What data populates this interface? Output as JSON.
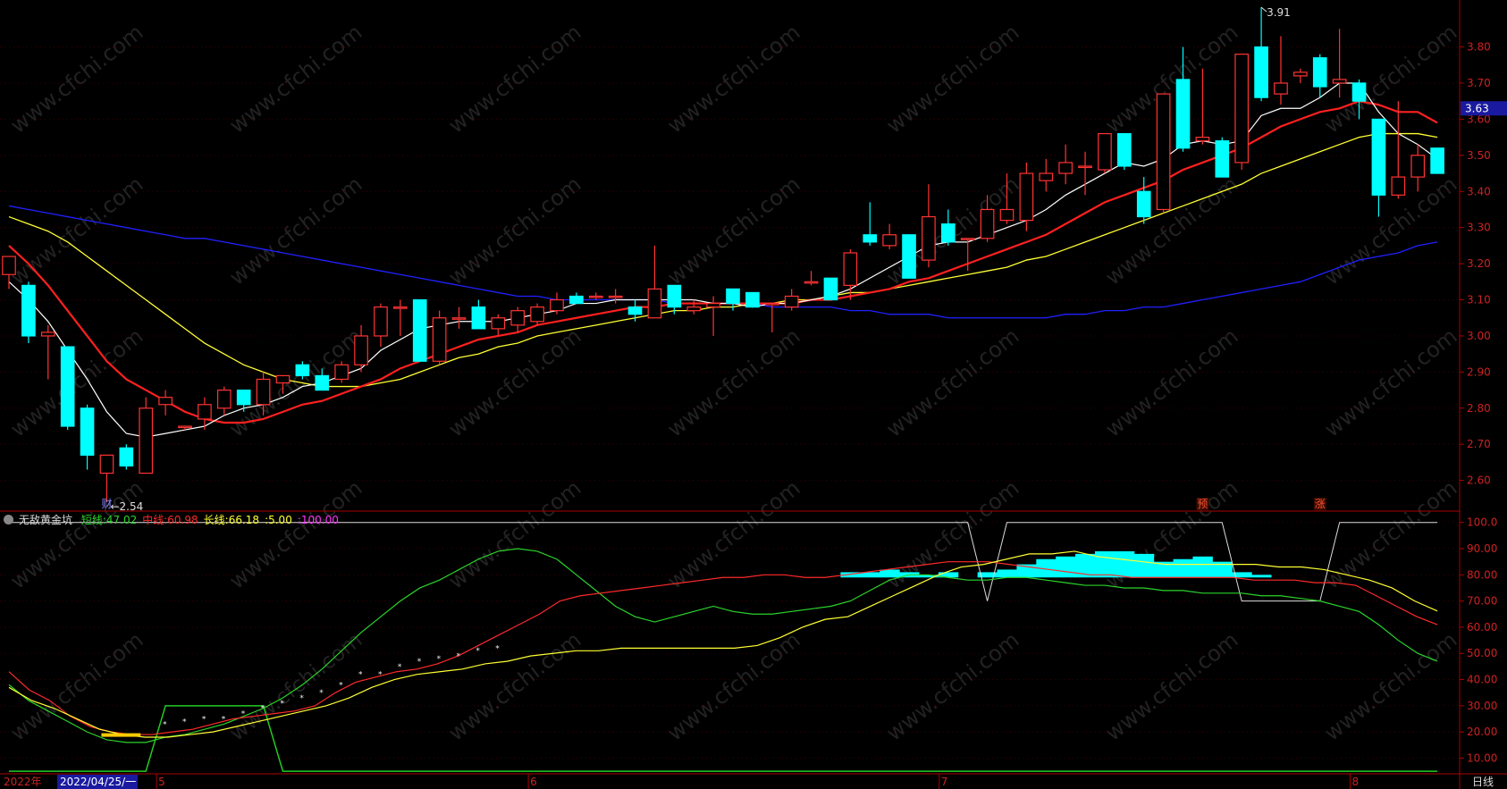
{
  "chart_data": [
    {
      "type": "candlestick",
      "ylim": [
        2.52,
        3.93
      ],
      "yticks": [
        "3.80",
        "3.70",
        "3.60",
        "3.50",
        "3.40",
        "3.30",
        "3.20",
        "3.10",
        "3.00",
        "2.90",
        "2.80",
        "2.70",
        "2.60"
      ],
      "ytick_values": [
        3.8,
        3.7,
        3.6,
        3.5,
        3.4,
        3.3,
        3.2,
        3.1,
        3.0,
        2.9,
        2.8,
        2.7,
        2.6
      ],
      "current_price": "3.63",
      "high_label": "3.91",
      "low_label": "2.54",
      "event_marks": [
        "财",
        "预",
        "涨"
      ],
      "bars": [
        {
          "o": 3.17,
          "h": 3.22,
          "l": 3.13,
          "c": 3.22
        },
        {
          "o": 3.14,
          "h": 3.15,
          "l": 2.98,
          "c": 3.0
        },
        {
          "o": 3.0,
          "h": 3.03,
          "l": 2.88,
          "c": 3.01
        },
        {
          "o": 2.97,
          "h": 2.97,
          "l": 2.74,
          "c": 2.75
        },
        {
          "o": 2.8,
          "h": 2.81,
          "l": 2.63,
          "c": 2.67
        },
        {
          "o": 2.62,
          "h": 2.67,
          "l": 2.54,
          "c": 2.67
        },
        {
          "o": 2.69,
          "h": 2.7,
          "l": 2.63,
          "c": 2.64
        },
        {
          "o": 2.62,
          "h": 2.83,
          "l": 2.62,
          "c": 2.8
        },
        {
          "o": 2.81,
          "h": 2.85,
          "l": 2.78,
          "c": 2.83
        },
        {
          "o": 2.75,
          "h": 2.75,
          "l": 2.74,
          "c": 2.75
        },
        {
          "o": 2.77,
          "h": 2.83,
          "l": 2.74,
          "c": 2.81
        },
        {
          "o": 2.8,
          "h": 2.86,
          "l": 2.78,
          "c": 2.85
        },
        {
          "o": 2.85,
          "h": 2.85,
          "l": 2.79,
          "c": 2.81
        },
        {
          "o": 2.81,
          "h": 2.9,
          "l": 2.78,
          "c": 2.88
        },
        {
          "o": 2.87,
          "h": 2.89,
          "l": 2.84,
          "c": 2.89
        },
        {
          "o": 2.92,
          "h": 2.93,
          "l": 2.88,
          "c": 2.89
        },
        {
          "o": 2.89,
          "h": 2.91,
          "l": 2.85,
          "c": 2.85
        },
        {
          "o": 2.88,
          "h": 2.93,
          "l": 2.87,
          "c": 2.92
        },
        {
          "o": 2.92,
          "h": 3.03,
          "l": 2.9,
          "c": 3.0
        },
        {
          "o": 3.0,
          "h": 3.09,
          "l": 2.97,
          "c": 3.08
        },
        {
          "o": 3.08,
          "h": 3.1,
          "l": 3.0,
          "c": 3.08
        },
        {
          "o": 3.1,
          "h": 3.1,
          "l": 2.93,
          "c": 2.93
        },
        {
          "o": 2.93,
          "h": 3.07,
          "l": 2.92,
          "c": 3.05
        },
        {
          "o": 3.05,
          "h": 3.08,
          "l": 3.02,
          "c": 3.05
        },
        {
          "o": 3.08,
          "h": 3.1,
          "l": 3.02,
          "c": 3.02
        },
        {
          "o": 3.02,
          "h": 3.06,
          "l": 3.0,
          "c": 3.05
        },
        {
          "o": 3.03,
          "h": 3.08,
          "l": 3.01,
          "c": 3.07
        },
        {
          "o": 3.04,
          "h": 3.09,
          "l": 3.03,
          "c": 3.08
        },
        {
          "o": 3.07,
          "h": 3.12,
          "l": 3.06,
          "c": 3.1
        },
        {
          "o": 3.11,
          "h": 3.12,
          "l": 3.09,
          "c": 3.09
        },
        {
          "o": 3.11,
          "h": 3.12,
          "l": 3.1,
          "c": 3.11
        },
        {
          "o": 3.11,
          "h": 3.13,
          "l": 3.09,
          "c": 3.11
        },
        {
          "o": 3.08,
          "h": 3.1,
          "l": 3.04,
          "c": 3.06
        },
        {
          "o": 3.05,
          "h": 3.25,
          "l": 3.05,
          "c": 3.13
        },
        {
          "o": 3.14,
          "h": 3.14,
          "l": 3.06,
          "c": 3.08
        },
        {
          "o": 3.07,
          "h": 3.1,
          "l": 3.06,
          "c": 3.08
        },
        {
          "o": 3.08,
          "h": 3.11,
          "l": 3.0,
          "c": 3.09
        },
        {
          "o": 3.13,
          "h": 3.13,
          "l": 3.07,
          "c": 3.09
        },
        {
          "o": 3.12,
          "h": 3.12,
          "l": 3.09,
          "c": 3.08
        },
        {
          "o": 3.09,
          "h": 3.09,
          "l": 3.01,
          "c": 3.09
        },
        {
          "o": 3.08,
          "h": 3.13,
          "l": 3.07,
          "c": 3.11
        },
        {
          "o": 3.15,
          "h": 3.18,
          "l": 3.14,
          "c": 3.15
        },
        {
          "o": 3.16,
          "h": 3.16,
          "l": 3.1,
          "c": 3.1
        },
        {
          "o": 3.14,
          "h": 3.24,
          "l": 3.1,
          "c": 3.23
        },
        {
          "o": 3.28,
          "h": 3.37,
          "l": 3.25,
          "c": 3.26
        },
        {
          "o": 3.25,
          "h": 3.31,
          "l": 3.24,
          "c": 3.28
        },
        {
          "o": 3.28,
          "h": 3.28,
          "l": 3.16,
          "c": 3.16
        },
        {
          "o": 3.21,
          "h": 3.42,
          "l": 3.19,
          "c": 3.33
        },
        {
          "o": 3.31,
          "h": 3.35,
          "l": 3.25,
          "c": 3.26
        },
        {
          "o": 3.27,
          "h": 3.27,
          "l": 3.18,
          "c": 3.27
        },
        {
          "o": 3.27,
          "h": 3.39,
          "l": 3.26,
          "c": 3.35
        },
        {
          "o": 3.32,
          "h": 3.45,
          "l": 3.31,
          "c": 3.35
        },
        {
          "o": 3.32,
          "h": 3.48,
          "l": 3.29,
          "c": 3.45
        },
        {
          "o": 3.43,
          "h": 3.49,
          "l": 3.4,
          "c": 3.45
        },
        {
          "o": 3.45,
          "h": 3.53,
          "l": 3.42,
          "c": 3.48
        },
        {
          "o": 3.47,
          "h": 3.51,
          "l": 3.39,
          "c": 3.47
        },
        {
          "o": 3.46,
          "h": 3.56,
          "l": 3.45,
          "c": 3.56
        },
        {
          "o": 3.56,
          "h": 3.56,
          "l": 3.46,
          "c": 3.47
        },
        {
          "o": 3.4,
          "h": 3.44,
          "l": 3.31,
          "c": 3.33
        },
        {
          "o": 3.35,
          "h": 3.67,
          "l": 3.34,
          "c": 3.67
        },
        {
          "o": 3.71,
          "h": 3.8,
          "l": 3.51,
          "c": 3.52
        },
        {
          "o": 3.54,
          "h": 3.74,
          "l": 3.53,
          "c": 3.55
        },
        {
          "o": 3.54,
          "h": 3.55,
          "l": 3.44,
          "c": 3.44
        },
        {
          "o": 3.48,
          "h": 3.78,
          "l": 3.46,
          "c": 3.78
        },
        {
          "o": 3.8,
          "h": 3.91,
          "l": 3.65,
          "c": 3.66
        },
        {
          "o": 3.67,
          "h": 3.83,
          "l": 3.64,
          "c": 3.7
        },
        {
          "o": 3.72,
          "h": 3.74,
          "l": 3.7,
          "c": 3.73
        },
        {
          "o": 3.77,
          "h": 3.78,
          "l": 3.66,
          "c": 3.69
        },
        {
          "o": 3.7,
          "h": 3.85,
          "l": 3.66,
          "c": 3.71
        },
        {
          "o": 3.7,
          "h": 3.71,
          "l": 3.6,
          "c": 3.65
        },
        {
          "o": 3.6,
          "h": 3.6,
          "l": 3.33,
          "c": 3.39
        },
        {
          "o": 3.39,
          "h": 3.65,
          "l": 3.38,
          "c": 3.44
        },
        {
          "o": 3.44,
          "h": 3.53,
          "l": 3.4,
          "c": 3.5
        },
        {
          "o": 3.52,
          "h": 3.52,
          "l": 3.45,
          "c": 3.45
        }
      ],
      "ma5": [
        3.15,
        3.1,
        3.04,
        2.96,
        2.88,
        2.79,
        2.73,
        2.72,
        2.73,
        2.74,
        2.75,
        2.78,
        2.8,
        2.81,
        2.83,
        2.86,
        2.87,
        2.89,
        2.91,
        2.96,
        2.99,
        3.02,
        3.03,
        3.04,
        3.04,
        3.04,
        3.05,
        3.06,
        3.07,
        3.09,
        3.09,
        3.1,
        3.1,
        3.1,
        3.1,
        3.1,
        3.09,
        3.09,
        3.08,
        3.09,
        3.09,
        3.1,
        3.11,
        3.13,
        3.16,
        3.19,
        3.22,
        3.25,
        3.26,
        3.26,
        3.28,
        3.3,
        3.32,
        3.35,
        3.39,
        3.42,
        3.45,
        3.48,
        3.47,
        3.49,
        3.53,
        3.54,
        3.53,
        3.54,
        3.61,
        3.63,
        3.63,
        3.66,
        3.7,
        3.7,
        3.62,
        3.56,
        3.53,
        3.49
      ],
      "ma10": [
        3.25,
        3.2,
        3.14,
        3.07,
        3.0,
        2.93,
        2.88,
        2.85,
        2.82,
        2.79,
        2.77,
        2.76,
        2.76,
        2.77,
        2.79,
        2.81,
        2.82,
        2.84,
        2.86,
        2.88,
        2.91,
        2.93,
        2.95,
        2.97,
        2.99,
        3.0,
        3.01,
        3.03,
        3.04,
        3.05,
        3.06,
        3.07,
        3.08,
        3.08,
        3.09,
        3.09,
        3.09,
        3.09,
        3.09,
        3.09,
        3.09,
        3.1,
        3.1,
        3.11,
        3.12,
        3.13,
        3.15,
        3.16,
        3.18,
        3.2,
        3.22,
        3.24,
        3.26,
        3.28,
        3.31,
        3.34,
        3.37,
        3.39,
        3.41,
        3.43,
        3.46,
        3.48,
        3.5,
        3.52,
        3.55,
        3.58,
        3.6,
        3.62,
        3.63,
        3.65,
        3.64,
        3.62,
        3.62,
        3.59
      ],
      "ma20": [
        3.33,
        3.31,
        3.29,
        3.26,
        3.22,
        3.18,
        3.14,
        3.1,
        3.06,
        3.02,
        2.98,
        2.95,
        2.92,
        2.9,
        2.88,
        2.87,
        2.86,
        2.86,
        2.86,
        2.87,
        2.88,
        2.9,
        2.92,
        2.94,
        2.95,
        2.97,
        2.98,
        3.0,
        3.01,
        3.02,
        3.03,
        3.04,
        3.05,
        3.06,
        3.07,
        3.07,
        3.08,
        3.08,
        3.09,
        3.09,
        3.1,
        3.1,
        3.11,
        3.12,
        3.12,
        3.13,
        3.14,
        3.15,
        3.16,
        3.17,
        3.18,
        3.19,
        3.21,
        3.22,
        3.24,
        3.26,
        3.28,
        3.3,
        3.32,
        3.34,
        3.36,
        3.38,
        3.4,
        3.42,
        3.45,
        3.47,
        3.49,
        3.51,
        3.53,
        3.55,
        3.56,
        3.56,
        3.56,
        3.55
      ],
      "ma60": [
        3.36,
        3.35,
        3.34,
        3.33,
        3.32,
        3.31,
        3.3,
        3.29,
        3.28,
        3.27,
        3.27,
        3.26,
        3.25,
        3.24,
        3.23,
        3.22,
        3.21,
        3.2,
        3.19,
        3.18,
        3.17,
        3.16,
        3.15,
        3.14,
        3.13,
        3.12,
        3.11,
        3.11,
        3.1,
        3.1,
        3.1,
        3.1,
        3.1,
        3.1,
        3.09,
        3.09,
        3.09,
        3.09,
        3.09,
        3.08,
        3.08,
        3.08,
        3.08,
        3.07,
        3.07,
        3.06,
        3.06,
        3.06,
        3.05,
        3.05,
        3.05,
        3.05,
        3.05,
        3.05,
        3.06,
        3.06,
        3.07,
        3.07,
        3.08,
        3.08,
        3.09,
        3.1,
        3.11,
        3.12,
        3.13,
        3.14,
        3.15,
        3.17,
        3.19,
        3.21,
        3.22,
        3.23,
        3.25,
        3.26
      ]
    },
    {
      "type": "line",
      "title": "无敌黄金坑",
      "ylim": [
        4,
        104
      ],
      "yticks": [
        "100.0",
        "90.00",
        "80.00",
        "70.00",
        "60.00",
        "50.00",
        "40.00",
        "30.00",
        "20.00",
        "10.00"
      ],
      "ytick_values": [
        100,
        90,
        80,
        70,
        60,
        50,
        40,
        30,
        20,
        10
      ],
      "legend": [
        {
          "label": "短线:",
          "value": "47.02",
          "color": "#2bd42b"
        },
        {
          "label": "中线:",
          "value": "60.98",
          "color": "#ff2a2a"
        },
        {
          "label": "长线:",
          "value": "66.18",
          "color": "#ffff33"
        },
        {
          "label": ":",
          "value": "5.00",
          "color": "#ffff33"
        },
        {
          "label": ":",
          "value": "100.00",
          "color": "#ff33ff"
        }
      ],
      "short": [
        38,
        32,
        28,
        24,
        20,
        17,
        16,
        16,
        18,
        19,
        21,
        23,
        26,
        29,
        33,
        38,
        44,
        51,
        58,
        64,
        70,
        75,
        78,
        82,
        86,
        89,
        90,
        89,
        86,
        80,
        74,
        68,
        64,
        62,
        64,
        66,
        68,
        66,
        65,
        65,
        66,
        67,
        68,
        70,
        74,
        78,
        80,
        80,
        79,
        78,
        78,
        79,
        79,
        78,
        77,
        76,
        76,
        75,
        75,
        74,
        74,
        73,
        73,
        73,
        72,
        72,
        71,
        70,
        68,
        66,
        61,
        55,
        50,
        47.02
      ],
      "mid": [
        43,
        36,
        32,
        26,
        22,
        20,
        19,
        19,
        20,
        21,
        23,
        25,
        26,
        27,
        28,
        30,
        35,
        39,
        41,
        43,
        44,
        46,
        49,
        53,
        57,
        61,
        65,
        70,
        72,
        73,
        74,
        75,
        76,
        77,
        78,
        79,
        79,
        80,
        80,
        79,
        79,
        80,
        81,
        82,
        83,
        84,
        85,
        85,
        85,
        84,
        83,
        82,
        81,
        80,
        80,
        79,
        79,
        79,
        79,
        79,
        79,
        78,
        78,
        78,
        77,
        77,
        76,
        72,
        68,
        64,
        60.98
      ],
      "long": [
        37,
        32,
        29,
        25,
        21,
        19,
        18,
        18,
        19,
        20,
        22,
        24,
        26,
        28,
        30,
        33,
        37,
        40,
        42,
        43,
        44,
        46,
        47,
        49,
        50,
        51,
        51,
        52,
        52,
        52,
        52,
        52,
        52,
        53,
        56,
        60,
        63,
        64,
        68,
        72,
        76,
        80,
        83,
        84,
        86,
        88,
        88,
        89,
        87,
        86,
        85,
        84,
        84,
        84,
        84,
        84,
        83,
        83,
        82,
        80,
        78,
        75,
        70,
        66.18
      ],
      "upper": [
        100,
        100,
        100,
        100,
        100,
        100,
        100,
        100,
        100,
        100,
        100,
        100,
        100,
        100,
        100,
        100,
        100,
        100,
        100,
        100,
        100,
        100,
        100,
        100,
        100,
        100,
        100,
        100,
        100,
        100,
        100,
        100,
        100,
        100,
        100,
        100,
        100,
        100,
        100,
        100,
        100,
        100,
        100,
        100,
        100,
        100,
        100,
        100,
        100,
        100,
        70,
        100,
        100,
        100,
        100,
        100,
        100,
        100,
        100,
        100,
        100,
        100,
        100,
        70,
        70,
        70,
        70,
        70,
        100,
        100,
        100,
        100,
        100,
        100
      ],
      "lower": [
        5,
        5,
        5,
        5,
        5,
        5,
        5,
        5,
        30,
        30,
        30,
        30,
        30,
        30,
        5,
        5,
        5,
        5,
        5,
        5,
        5,
        5,
        5,
        5,
        5,
        5,
        5,
        5,
        5,
        5,
        5,
        5,
        5,
        5,
        5,
        5,
        5,
        5,
        5,
        5,
        5,
        5,
        5,
        5,
        5,
        5,
        5,
        5,
        5,
        5,
        5,
        5,
        5,
        5,
        5,
        5,
        5,
        5,
        5,
        5,
        5,
        5,
        5,
        5,
        5,
        5,
        5,
        5,
        5,
        5,
        5,
        5,
        5,
        5
      ],
      "histogram": [
        0,
        0,
        0,
        0,
        0,
        0,
        0,
        0,
        0,
        0,
        0,
        0,
        0,
        0,
        0,
        0,
        0,
        0,
        0,
        0,
        0,
        0,
        0,
        0,
        0,
        0,
        0,
        0,
        0,
        0,
        0,
        0,
        0,
        0,
        0,
        0,
        0,
        0,
        0,
        0,
        0,
        0,
        0,
        81,
        81,
        82,
        81,
        80,
        81,
        0,
        81,
        82,
        84,
        86,
        87,
        88,
        89,
        89,
        88,
        85,
        86,
        87,
        85,
        81,
        80,
        0,
        0,
        0,
        0,
        0,
        0,
        0,
        0,
        0,
        0
      ]
    }
  ],
  "x_axis": {
    "labels": [
      {
        "text": "2022年",
        "idx": 0
      },
      {
        "text": "5",
        "idx": 8
      },
      {
        "text": "6",
        "idx": 27
      },
      {
        "text": "7",
        "idx": 48
      },
      {
        "text": "8",
        "idx": 69
      }
    ],
    "cursor_date": "2022/04/25/一",
    "period": "日线"
  },
  "watermark": "www.cfchi.com",
  "colors": {
    "up": "#ff3333",
    "down": "#00ffff",
    "ma5": "#ffffff",
    "ma10": "#ff2020",
    "ma20": "#ffff33",
    "ma60": "#2020ff",
    "axis": "#aa0000",
    "tick_text": "#cc2222"
  }
}
